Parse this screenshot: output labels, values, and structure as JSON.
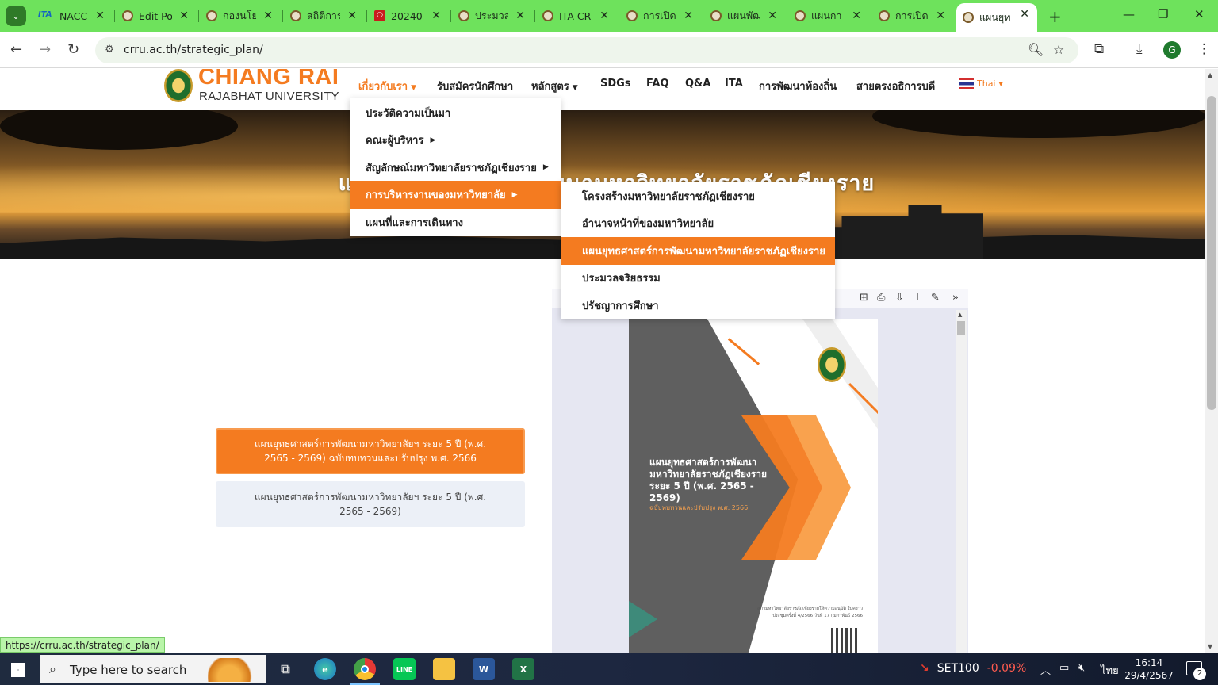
{
  "browser": {
    "tabs": [
      {
        "title": "NACC",
        "favicon": "ita"
      },
      {
        "title": "Edit Po",
        "favicon": "crru-seal"
      },
      {
        "title": "กองนโย",
        "favicon": "crru-seal"
      },
      {
        "title": "สถิติการ",
        "favicon": "crru-seal"
      },
      {
        "title": "20240",
        "favicon": "pdf"
      },
      {
        "title": "ประมวล",
        "favicon": "crru-seal"
      },
      {
        "title": "ITA CR",
        "favicon": "crru-seal"
      },
      {
        "title": "การเปิด",
        "favicon": "crru-seal"
      },
      {
        "title": "แผนพัฒ",
        "favicon": "crru-seal"
      },
      {
        "title": "แผนกา",
        "favicon": "crru-seal"
      },
      {
        "title": "การเปิด",
        "favicon": "crru-seal"
      },
      {
        "title": "แผนยุท",
        "favicon": "crru-seal",
        "active": true
      }
    ],
    "url": "crru.ac.th/strategic_plan/",
    "profile_initial": "G",
    "status_url": "https://crru.ac.th/strategic_plan/"
  },
  "site": {
    "logo_main": "CHIANG RAI",
    "logo_sub": "RAJABHAT UNIVERSITY",
    "nav": [
      {
        "label": "เกี่ยวกับเรา",
        "has_caret": true,
        "current": true
      },
      {
        "label": "รับสมัครนักศึกษา",
        "has_caret": false
      },
      {
        "label": "หลักสูตร",
        "has_caret": true
      },
      {
        "label": "SDGs",
        "has_caret": false
      },
      {
        "label": "FAQ",
        "has_caret": false
      },
      {
        "label": "Q&A",
        "has_caret": false
      },
      {
        "label": "ITA",
        "has_caret": false
      },
      {
        "label": "การพัฒนาท้องถิ่น",
        "has_caret": false
      },
      {
        "label": "สายตรงอธิการบดี",
        "has_caret": false
      }
    ],
    "language": "Thai",
    "hero_title": "แผนยุทธศาสตร์การพัฒนามหาวิทยาลัยราชภัฏเชียงราย"
  },
  "menu_main": [
    {
      "label": "ประวัติความเป็นมา",
      "submenu": false
    },
    {
      "label": "คณะผู้บริหาร",
      "submenu": true
    },
    {
      "label": "สัญลักษณ์มหาวิทยาลัยราชภัฏเชียงราย",
      "submenu": true
    },
    {
      "label": "การบริหารงานของมหาวิทยาลัย",
      "submenu": true,
      "highlight": true
    },
    {
      "label": "แผนที่และการเดินทาง",
      "submenu": false
    }
  ],
  "menu_sub": [
    {
      "label": "โครงสร้างมหาวิทยาลัยราชภัฏเชียงราย"
    },
    {
      "label": "อำนาจหน้าที่ของมหาวิทยาลัย"
    },
    {
      "label": "แผนยุทธศาสตร์การพัฒนามหาวิทยาลัยราชภัฏเชียงราย",
      "highlight": true
    },
    {
      "label": "ประมวลจริยธรรม"
    },
    {
      "label": "ปรัชญาการศึกษา"
    }
  ],
  "plans": [
    {
      "label": "แผนยุทธศาสตร์การพัฒนามหาวิทยาลัยฯ ระยะ 5 ปี (พ.ศ. 2565 - 2569) ฉบับทบทวนและปรับปรุง พ.ศ. 2566",
      "active": true
    },
    {
      "label": "แผนยุทธศาสตร์การพัฒนามหาวิทยาลัยฯ ระยะ 5 ปี (พ.ศ. 2565 - 2569)",
      "active": false
    }
  ],
  "pdf": {
    "cover_title": "แผนยุทธศาสตร์การพัฒนา มหาวิทยาลัยราชภัฏเชียงราย ระยะ 5 ปี (พ.ศ. 2565 - 2569)",
    "cover_subtitle": "ฉบับทบทวนและปรับปรุง พ.ศ. 2566",
    "cover_footer": "สภามหาวิทยาลัยราชภัฏเชียงรายให้ความอนุมัติ ในคราวประชุมครั้งที่ 4/2566 วันที่ 17 กุมภาพันธ์ 2566",
    "tools": [
      "comment-icon",
      "print-icon",
      "save-icon",
      "text-cursor-icon",
      "draw-icon",
      "more-icon"
    ]
  },
  "taskbar": {
    "search_placeholder": "Type here to search",
    "apps": [
      "task-view",
      "edge",
      "chrome",
      "line",
      "file-explorer",
      "word",
      "excel"
    ],
    "ticker_name": "SET100",
    "ticker_change": "-0.09%",
    "ime": "ไทย",
    "time": "16:14",
    "date": "29/4/2567",
    "notifications": "2"
  },
  "colors": {
    "accent": "#f47b20",
    "chrome_green": "#6ee25c"
  }
}
